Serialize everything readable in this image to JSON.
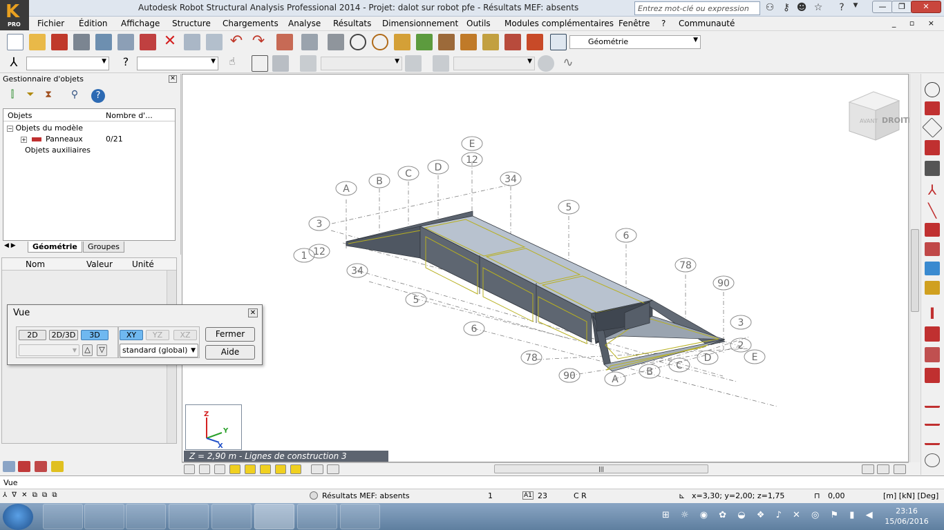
{
  "window": {
    "title": "Autodesk Robot Structural Analysis Professional 2014 - Projet: dalot sur robot pfe - Résultats MEF: absents",
    "logo_label": "PRO",
    "search_placeholder": "Entrez mot-clé ou expression",
    "btn_minimize": "—",
    "btn_restore": "❐",
    "btn_close": "✕"
  },
  "menu": {
    "items": [
      "Fichier",
      "Édition",
      "Affichage",
      "Structure",
      "Chargements",
      "Analyse",
      "Résultats",
      "Dimensionnement",
      "Outils",
      "Modules complémentaires",
      "Fenêtre",
      "?",
      "Communauté"
    ],
    "mdi_buttons": "_ ▫ ×"
  },
  "toolbar": {
    "layout_combo": "Géométrie"
  },
  "object_manager": {
    "title": "Gestionnaire d'objets",
    "col_objects": "Objets",
    "col_count": "Nombre d'...",
    "tree": {
      "model_objects": "Objets du modèle",
      "panels_label": "Panneaux",
      "panels_count": "0/21",
      "aux_objects": "Objets auxiliaires"
    },
    "tabs": [
      "Géométrie",
      "Groupes"
    ]
  },
  "properties": {
    "col_name": "Nom",
    "col_value": "Valeur",
    "col_unit": "Unité"
  },
  "vue_dialog": {
    "title": "Vue",
    "btn_2d": "2D",
    "btn_2d3d": "2D/3D",
    "btn_3d": "3D",
    "btn_xy": "XY",
    "btn_yz": "YZ",
    "btn_xz": "XZ",
    "btn_up": "△",
    "btn_down": "▽",
    "projection": "standard (global)",
    "btn_close": "Fermer",
    "btn_help": "Aide"
  },
  "viewport": {
    "status": "Z = 2,90 m - Lignes de construction 3",
    "view_cube_front": "AVANT",
    "view_cube_right": "DROITE",
    "axis_z": "Z",
    "axis_y": "Y",
    "axis_x": "X",
    "grid_labels_top": [
      "A",
      "B",
      "C",
      "D",
      "E",
      "12",
      "34",
      "5",
      "6",
      "78",
      "90",
      "3",
      "12",
      "3",
      "1",
      "2",
      "34"
    ],
    "grid_labels_bottom": [
      "5",
      "6",
      "78",
      "90",
      "A",
      "B",
      "C",
      "D",
      "E",
      "3",
      "2",
      "1"
    ]
  },
  "command_line": {
    "text": "Vue"
  },
  "statusbar": {
    "results": "Résultats MEF: absents",
    "field1": "1",
    "field2": "23",
    "field3": "C R",
    "coords": "x=3,30; y=2,00; z=1,75",
    "angle": "0,00",
    "units": "[m] [kN] [Deg]"
  },
  "taskbar": {
    "time": "23:16",
    "date": "15/06/2016"
  },
  "colors": {
    "accent": "#6fb8f0",
    "panel_fill": "#b5bfcc",
    "panel_dark": "#5f6772",
    "panel_edge": "#b8b020"
  }
}
